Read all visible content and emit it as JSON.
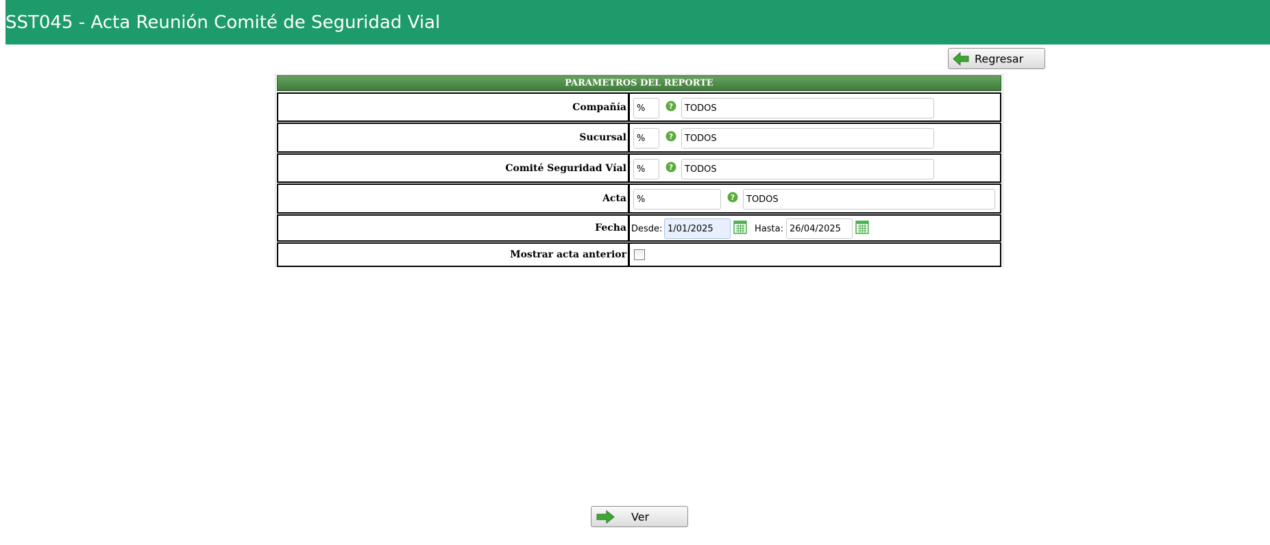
{
  "header": {
    "title": "SST045 - Acta Reunión Comité de Seguridad Vial"
  },
  "toolbar": {
    "back_label": "Regresar"
  },
  "panel": {
    "title": "PARAMETROS DEL REPORTE",
    "compania": {
      "label": "Compañía",
      "code": "%",
      "description": "TODOS"
    },
    "sucursal": {
      "label": "Sucursal",
      "code": "%",
      "description": "TODOS"
    },
    "comite": {
      "label": "Comité Seguridad Víal",
      "code": "%",
      "description": "TODOS"
    },
    "acta": {
      "label": "Acta",
      "code": "%",
      "description": "TODOS"
    },
    "fecha": {
      "label": "Fecha",
      "desde_label": "Desde:",
      "desde_value": "1/01/2025",
      "hasta_label": "Hasta:",
      "hasta_value": "26/04/2025"
    },
    "mostrar": {
      "label": "Mostrar acta anterior",
      "checked": false
    }
  },
  "footer": {
    "view_label": "Ver"
  },
  "colors": {
    "header": "#1e9b6a",
    "panel_title": "#4f8c48",
    "arrow": "#3fa535"
  },
  "icons": [
    "arrow-left-icon",
    "arrow-right-icon",
    "help-icon",
    "calendar-icon"
  ]
}
